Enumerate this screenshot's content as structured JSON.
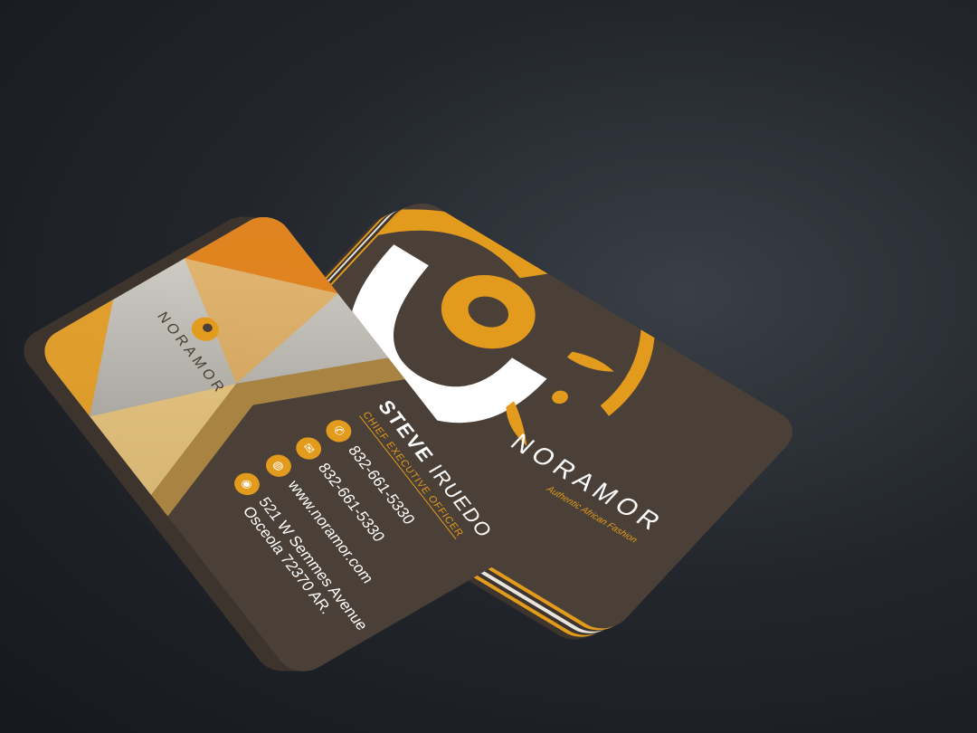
{
  "brand": {
    "name": "NORAMOR",
    "tagline": "Authentic African Fashion"
  },
  "contact": {
    "first_name": "STEVE",
    "last_name": "IRUEDO",
    "title": "CHIEF EXECUTIVE OFFICER",
    "phone1": "832-661-5330",
    "phone2": "832-661-5330",
    "website": "www.noramor.com",
    "address_line1": "521 W Semmes Avenue",
    "address_line2": "Osceola 72370 AR."
  },
  "colors": {
    "card": "#4a4038",
    "accent": "#e39b1d",
    "logo_white": "#ffffff",
    "background": "#23272d"
  },
  "icons": [
    "phone-icon",
    "mail-icon",
    "globe-icon",
    "location-icon"
  ]
}
